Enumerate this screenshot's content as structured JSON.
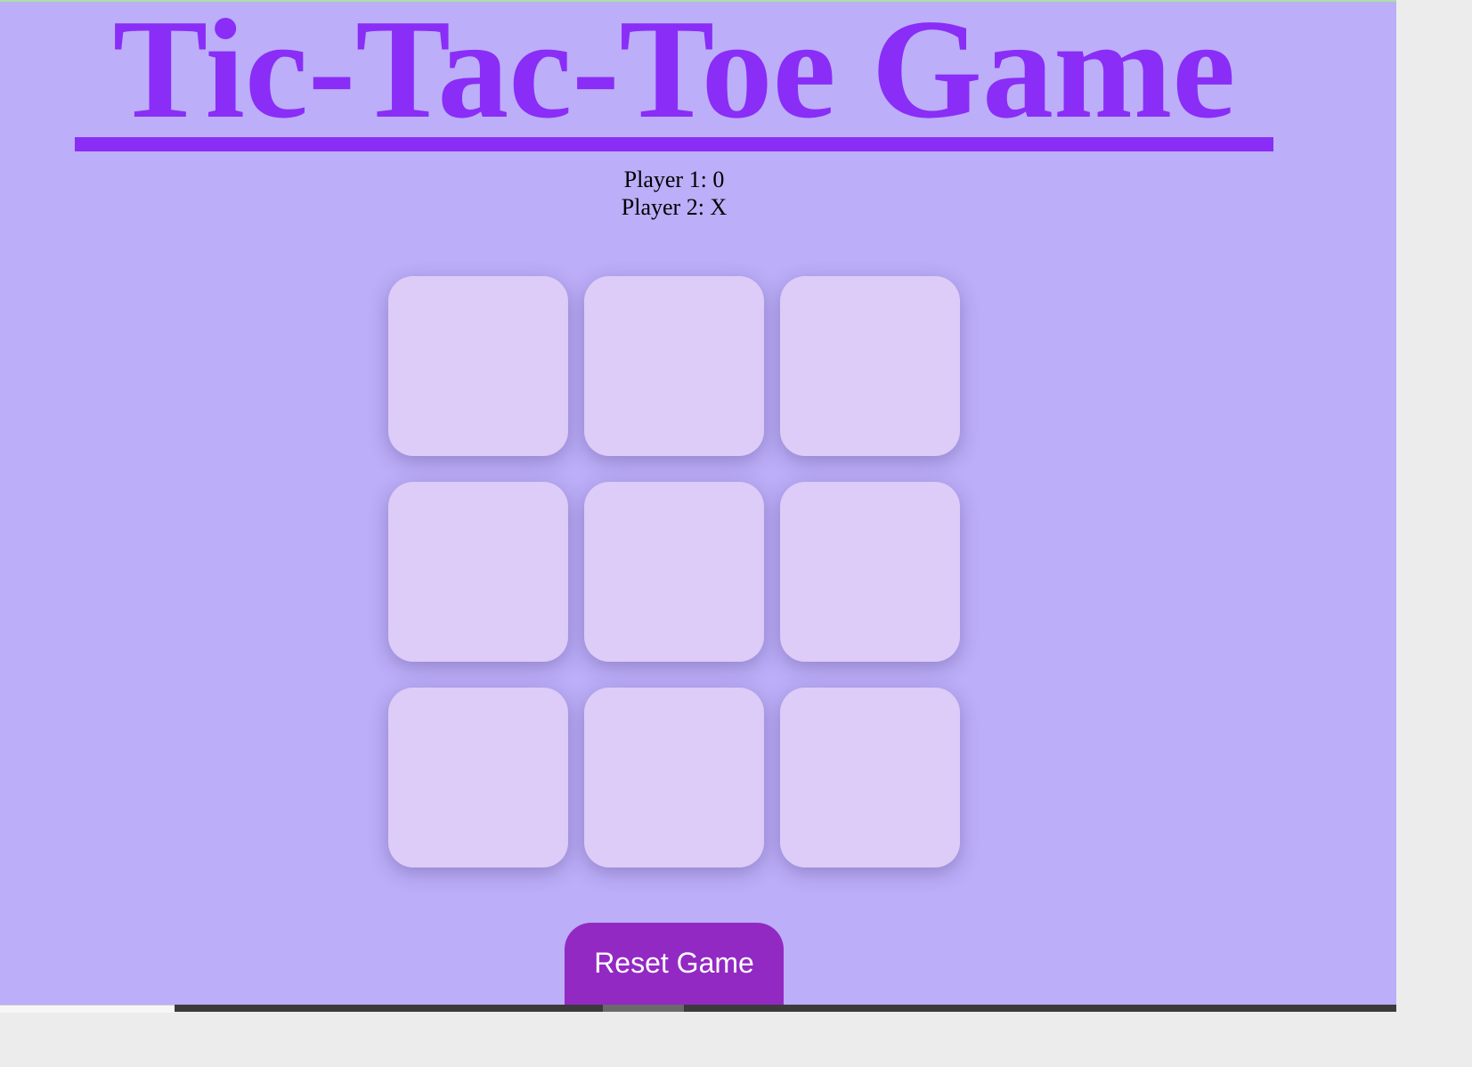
{
  "game": {
    "title": "Tic-Tac-Toe Game",
    "player1_label": "Player 1: 0",
    "player2_label": "Player 2: X",
    "board": [
      "",
      "",
      "",
      "",
      "",
      "",
      "",
      "",
      ""
    ],
    "reset_label": "Reset Game"
  },
  "colors": {
    "background": "#bcaef8",
    "title": "#8a2df7",
    "cell": "#ddcbf8",
    "reset_button": "#9329c3"
  }
}
